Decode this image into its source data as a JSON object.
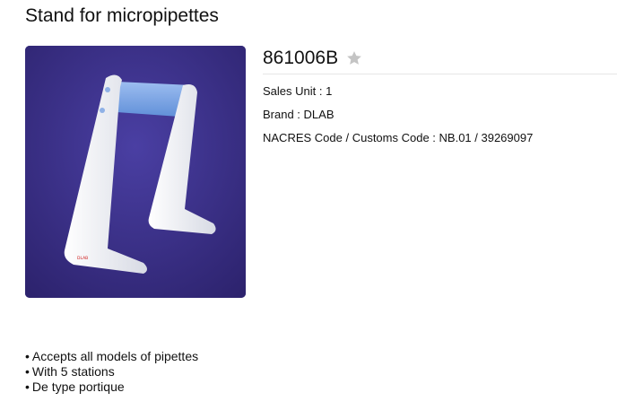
{
  "page": {
    "title": "Stand for micropipettes"
  },
  "product": {
    "reference": "861006B",
    "image_icon": "product-photo",
    "favorite_icon": "star-icon",
    "favorite_color": "#c4c4c4",
    "sales_unit": "Sales Unit : 1",
    "brand": "Brand : DLAB",
    "nacres": "NACRES Code / Customs Code : NB.01 / 39269097",
    "image_logo_text": "DLAB"
  },
  "features": [
    "Accepts all models of pipettes",
    "With 5 stations",
    "De type portique"
  ],
  "colors": {
    "photo_background": "#3b2f8a",
    "stand_body": "#f4f5f8",
    "stand_bar": "#7aa6e6"
  }
}
